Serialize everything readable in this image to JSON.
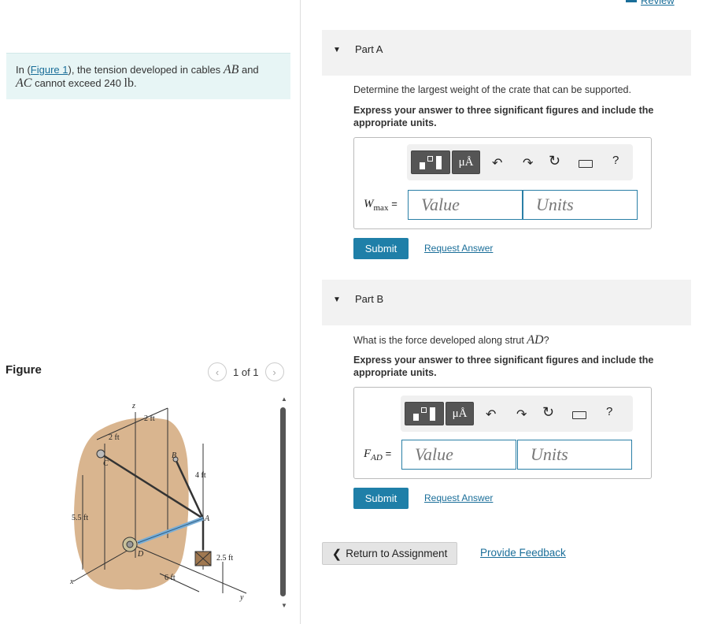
{
  "problem": {
    "prefix": "In (",
    "figure_link": "Figure 1",
    "text1": "), the tension developed in cables ",
    "cable1": "AB",
    "and": " and",
    "cable2": "AC",
    "text2": " cannot exceed 240 ",
    "unit": "lb",
    "end": "."
  },
  "figure": {
    "title": "Figure",
    "pager": "1 of 1",
    "prev_icon": "chevron-left-icon",
    "next_icon": "chevron-right-icon",
    "labels": {
      "z": "z",
      "two_ft_top": "2 ft",
      "two_ft_left": "2 ft",
      "C": "C",
      "B": "B",
      "four_ft": "4 ft",
      "five_five_ft": "5.5 ft",
      "A": "A",
      "D": "D",
      "two_five_ft": "2.5 ft",
      "six_ft": "6 ft",
      "x": "x",
      "y": "y"
    }
  },
  "header": {
    "review": "Review"
  },
  "partA": {
    "label": "Part A",
    "question": "Determine the largest weight of the crate that can be supported.",
    "instruction": "Express your answer to three significant figures and include the appropriate units.",
    "var_main": "W",
    "var_sub": "max",
    "equals": "=",
    "value_placeholder": "Value",
    "units_placeholder": "Units",
    "submit": "Submit",
    "request": "Request Answer"
  },
  "partB": {
    "label": "Part B",
    "question_prefix": "What is the force developed along strut ",
    "strut": "AD",
    "question_suffix": "?",
    "instruction": "Express your answer to three significant figures and include the appropriate units.",
    "var_main": "F",
    "var_sub": "AD",
    "equals": "=",
    "value_placeholder": "Value",
    "units_placeholder": "Units",
    "submit": "Submit",
    "request": "Request Answer"
  },
  "toolbar": {
    "units_button": "μÅ",
    "undo_icon": "undo-icon",
    "redo_icon": "redo-icon",
    "reset_icon": "reset-icon",
    "keyboard_icon": "keyboard-icon",
    "help": "?"
  },
  "footer": {
    "return_label": "Return to Assignment",
    "feedback": "Provide Feedback"
  }
}
